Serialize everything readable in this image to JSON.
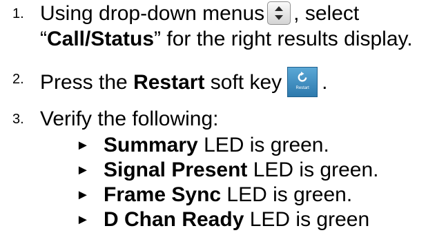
{
  "steps": [
    {
      "number": "1.",
      "line1_pre": "Using drop-down menus",
      "line1_post": ", select",
      "line2_open_quote": "“",
      "line2_bold": "Call/Status",
      "line2_rest": "” for the right results display.",
      "icon": "up-down-arrows-icon"
    },
    {
      "number": "2.",
      "pre": "Press the ",
      "bold": "Restart",
      "post": " soft key",
      "end": ".",
      "key": {
        "label": "Restart",
        "icon": "restart-icon",
        "color": "#3a87bd"
      }
    },
    {
      "number": "3.",
      "text": "Verify the following:",
      "bullet_glyph": "►",
      "items": [
        {
          "bold": "Summary",
          "rest": " LED is green."
        },
        {
          "bold": "Signal Present",
          "rest": " LED is green."
        },
        {
          "bold": "Frame Sync",
          "rest": " LED is green."
        },
        {
          "bold": "D Chan Ready",
          "rest": " LED is green"
        }
      ]
    }
  ]
}
